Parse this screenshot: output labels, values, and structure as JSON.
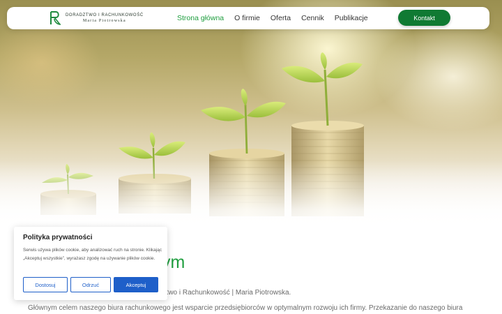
{
  "nav": {
    "logo": {
      "line1": "DORADZTWO I RACHUNKOWOŚĆ",
      "line2": "Maria Piotrowska",
      "mark_color": "#1f8a3e"
    },
    "items": [
      {
        "label": "Strona główna",
        "active": true
      },
      {
        "label": "O firmie",
        "active": false
      },
      {
        "label": "Oferta",
        "active": false
      },
      {
        "label": "Cennik",
        "active": false
      },
      {
        "label": "Publikacje",
        "active": false
      }
    ],
    "cta": "Kontakt"
  },
  "content": {
    "heading_visible": "ym",
    "subtitle_visible": "dztwo i Rachunkowość | Maria Piotrowska.",
    "paragraph": "Głównym celem naszego biura rachunkowego jest wsparcie przedsiębiorców w optymalnym rozwoju ich firmy. Przekazanie do naszego biura"
  },
  "cookie_banner": {
    "title": "Polityka prywatności",
    "text": "Serwis używa plików cookie, aby analizować ruch na stronie. Klikając „Akceptuj wszystkie”, wyrażasz zgodę na używanie plików cookie.",
    "buttons": {
      "customize": "Dostosuj",
      "reject": "Odrzuć",
      "accept": "Akceptuj"
    }
  },
  "colors": {
    "accent_green": "#1f9e3f",
    "cta_green": "#107a33",
    "cookie_blue": "#1e5fc9"
  }
}
